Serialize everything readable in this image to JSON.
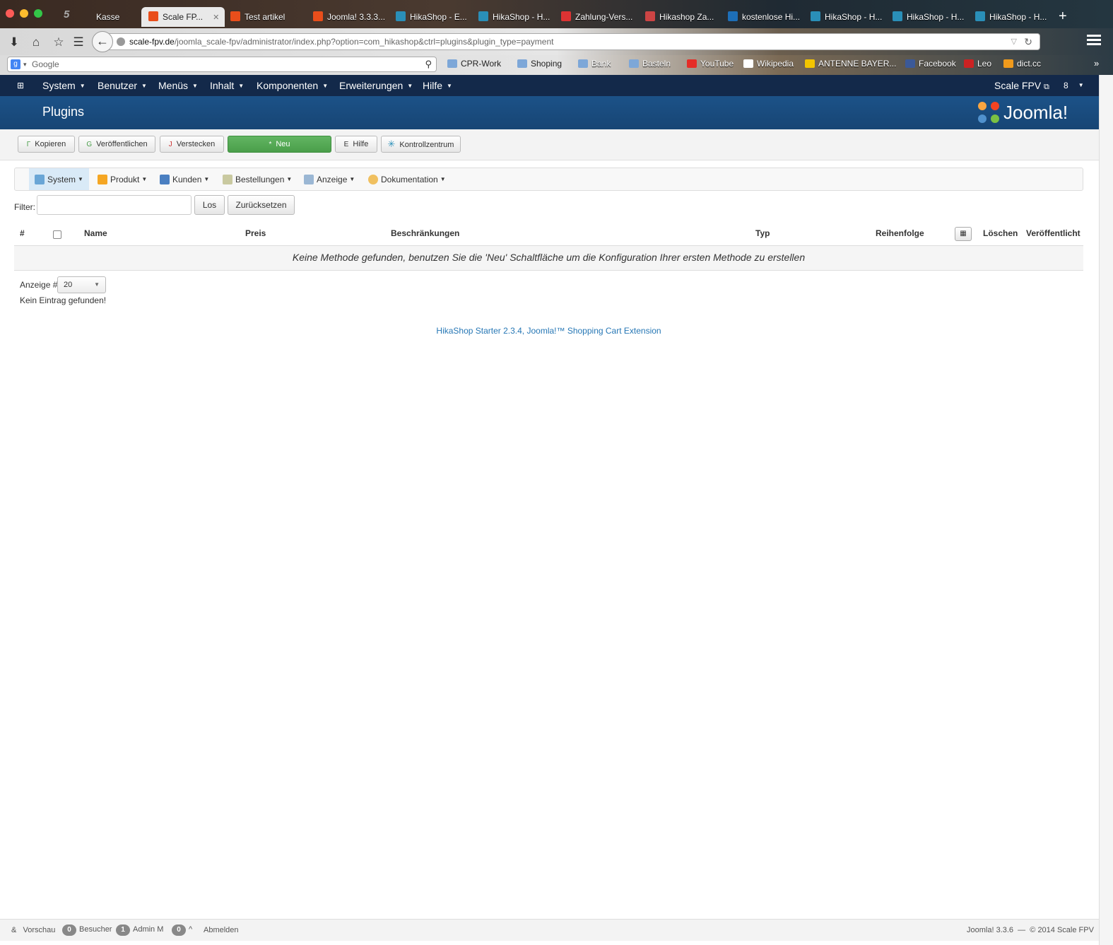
{
  "browser": {
    "tabs": [
      {
        "label": "Kasse"
      },
      {
        "label": "Scale FP..."
      },
      {
        "label": "Test artikel"
      },
      {
        "label": "Joomla! 3.3.3..."
      },
      {
        "label": "HikaShop - E..."
      },
      {
        "label": "HikaShop - H..."
      },
      {
        "label": "Zahlung-Vers..."
      },
      {
        "label": "Hikashop Za..."
      },
      {
        "label": "kostenlose Hi..."
      },
      {
        "label": "HikaShop - H..."
      },
      {
        "label": "HikaShop - H..."
      },
      {
        "label": "HikaShop - H..."
      }
    ],
    "url_host": "scale-fpv.de",
    "url_path": "/joomla_scale-fpv/administrator/index.php?option=com_hikashop&ctrl=plugins&plugin_type=payment",
    "search_placeholder": "Google",
    "bookmarks": [
      {
        "label": "CPR-Work"
      },
      {
        "label": "Shoping"
      },
      {
        "label": "Bank"
      },
      {
        "label": "Basteln"
      },
      {
        "label": "YouTube"
      },
      {
        "label": "Wikipedia"
      },
      {
        "label": "ANTENNE BAYER..."
      },
      {
        "label": "Facebook"
      },
      {
        "label": "Leo"
      },
      {
        "label": "dict.cc"
      }
    ]
  },
  "joomla": {
    "menu": [
      {
        "label": "System"
      },
      {
        "label": "Benutzer"
      },
      {
        "label": "Menüs"
      },
      {
        "label": "Inhalt"
      },
      {
        "label": "Komponenten"
      },
      {
        "label": "Erweiterungen"
      },
      {
        "label": "Hilfe"
      }
    ],
    "site_name": "Scale FPV",
    "user_count": "8",
    "page_title": "Plugins",
    "logo_text": "Joomla!",
    "toolbar": [
      {
        "icon": "Γ",
        "label": "Kopieren"
      },
      {
        "icon": "G",
        "label": "Veröffentlichen"
      },
      {
        "icon": "J",
        "label": "Verstecken"
      },
      {
        "icon": "*",
        "label": "Neu"
      },
      {
        "icon": "E",
        "label": "Hilfe"
      },
      {
        "icon": "✳",
        "label": "Kontrollzentrum"
      }
    ]
  },
  "hikashop": {
    "menu": [
      {
        "label": "System"
      },
      {
        "label": "Produkt"
      },
      {
        "label": "Kunden"
      },
      {
        "label": "Bestellungen"
      },
      {
        "label": "Anzeige"
      },
      {
        "label": "Dokumentation"
      }
    ],
    "filter_label": "Filter:",
    "filter_value": "",
    "go_label": "Los",
    "reset_label": "Zurücksetzen",
    "columns": [
      "#",
      "Name",
      "Preis",
      "Beschränkungen",
      "Typ",
      "Reihenfolge",
      "Löschen",
      "Veröffentlicht"
    ],
    "empty_message": "Keine Methode gefunden, benutzen Sie die 'Neu' Schaltfläche um die Konfiguration Ihrer ersten Methode zu erstellen",
    "display_label": "Anzeige #",
    "display_value": "20",
    "no_entry": "Kein Eintrag gefunden!",
    "footer": "HikaShop Starter 2.3.4, Joomla!™ Shopping Cart Extension"
  },
  "statusbar": {
    "preview_label": "Vorschau",
    "visitors_count": "0",
    "visitors_label": "Besucher",
    "admin_count": "1",
    "admin_label": "Admin M",
    "messages_count": "0",
    "logout_label": "Abmelden",
    "version": "Joomla! 3.3.6",
    "copyright": "© 2014 Scale FPV"
  },
  "colors": {
    "joomla_nav": "#13294a",
    "joomla_header": "#1c5288",
    "new_button": "#4a9e4a",
    "link": "#2677b5"
  }
}
